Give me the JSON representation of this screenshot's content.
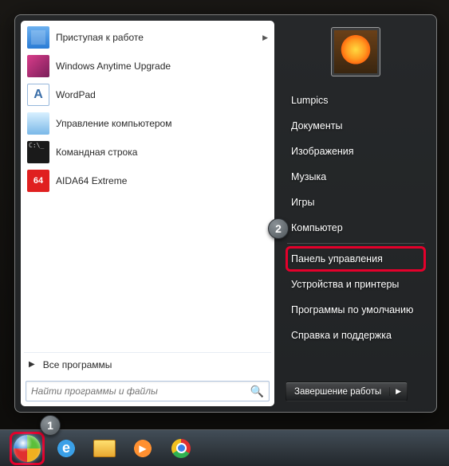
{
  "programs": [
    {
      "label": "Приступая к работе",
      "icon": "flag",
      "has_submenu": true
    },
    {
      "label": "Windows Anytime Upgrade",
      "icon": "anytime",
      "has_submenu": false
    },
    {
      "label": "WordPad",
      "icon": "wordpad",
      "has_submenu": false
    },
    {
      "label": "Управление компьютером",
      "icon": "manage",
      "has_submenu": false
    },
    {
      "label": "Командная строка",
      "icon": "cmd",
      "has_submenu": false
    },
    {
      "label": "AIDA64 Extreme",
      "icon": "aida",
      "has_submenu": false
    }
  ],
  "all_programs": "Все программы",
  "search": {
    "placeholder": "Найти программы и файлы"
  },
  "right_items": [
    "Lumpics",
    "Документы",
    "Изображения",
    "Музыка",
    "Игры",
    "Компьютер",
    "Панель управления",
    "Устройства и принтеры",
    "Программы по умолчанию",
    "Справка и поддержка"
  ],
  "shutdown_label": "Завершение работы",
  "markers": {
    "one": "1",
    "two": "2"
  },
  "highlighted_right_index": 6
}
